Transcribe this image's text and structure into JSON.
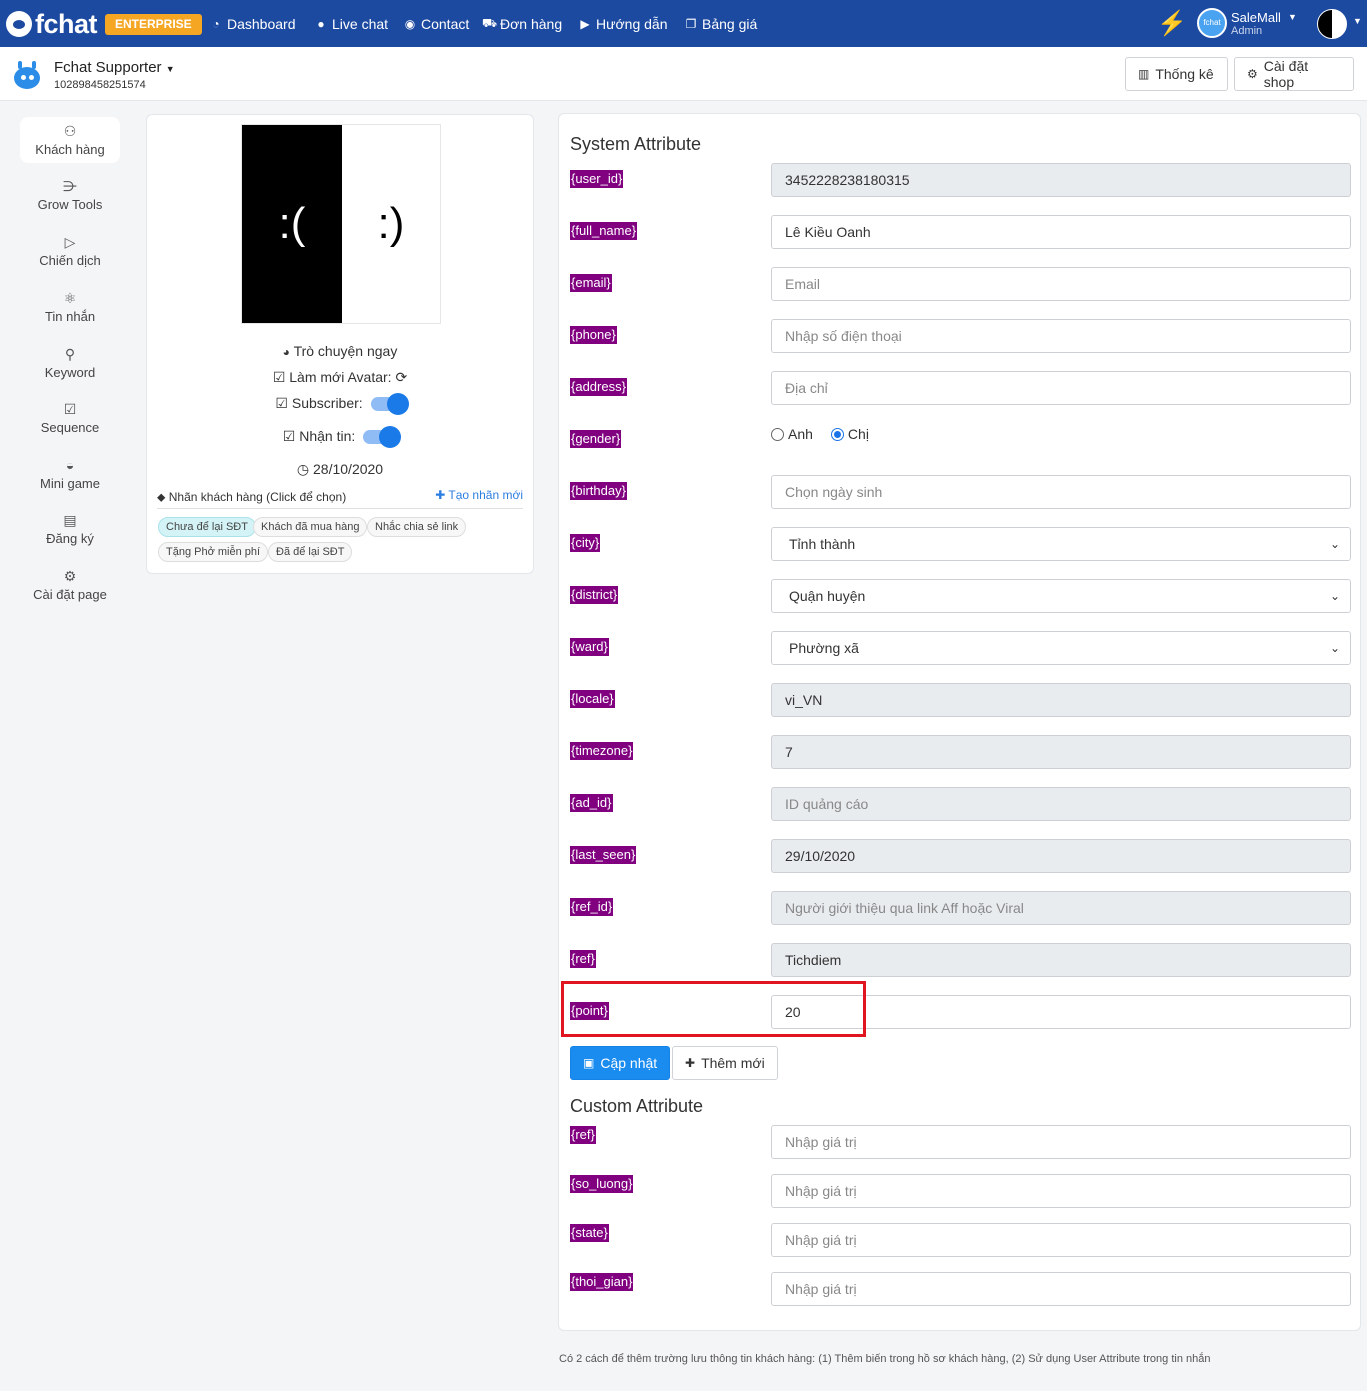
{
  "topbar": {
    "brand": "fchat",
    "badge": "ENTERPRISE",
    "nav": [
      {
        "label": "Dashboard",
        "icon": "dashboard-icon"
      },
      {
        "label": "Live chat",
        "icon": "chat-icon"
      },
      {
        "label": "Contact",
        "icon": "contact-icon"
      },
      {
        "label": "Đơn hàng",
        "icon": "cart-icon"
      },
      {
        "label": "Hướng dẫn",
        "icon": "play-icon"
      },
      {
        "label": "Bảng giá",
        "icon": "pricing-icon"
      }
    ],
    "account": {
      "name": "SaleMall",
      "role": "Admin",
      "avatar_text": "fchat"
    }
  },
  "page_header": {
    "page_name": "Fchat Supporter",
    "page_id": "102898458251574",
    "buttons": {
      "stats": "Thống kê",
      "settings": "Cài đặt shop"
    }
  },
  "sidebar": {
    "items": [
      {
        "label": "Khách hàng",
        "icon": "user-icon",
        "active": true
      },
      {
        "label": "Grow Tools",
        "icon": "grow-tools-icon"
      },
      {
        "label": "Chiến dịch",
        "icon": "campaign-icon"
      },
      {
        "label": "Tin nhắn",
        "icon": "message-icon"
      },
      {
        "label": "Keyword",
        "icon": "key-icon"
      },
      {
        "label": "Sequence",
        "icon": "calendar-icon"
      },
      {
        "label": "Mini game",
        "icon": "gamepad-icon"
      },
      {
        "label": "Đăng ký",
        "icon": "form-icon"
      },
      {
        "label": "Cài đặt page",
        "icon": "gear-icon"
      }
    ]
  },
  "profile": {
    "avatar_left": ":(",
    "avatar_right": ":)",
    "chat_now": "Trò chuyện ngay",
    "refresh_avatar": "Làm mới Avatar:",
    "subscriber": "Subscriber:",
    "subscriber_on": true,
    "receive_msg": "Nhận tin:",
    "receive_on": true,
    "date": "28/10/2020",
    "tags_title": "Nhãn khách hàng (Click để chọn)",
    "new_tag": "Tạo nhãn mới",
    "tags": [
      {
        "label": "Chưa để lại SĐT",
        "selected": true
      },
      {
        "label": "Khách đã mua hàng",
        "selected": false
      },
      {
        "label": "Nhắc chia sẻ link",
        "selected": false
      },
      {
        "label": "Tặng Phở miễn phí",
        "selected": false
      },
      {
        "label": "Đã để lại SĐT",
        "selected": false
      }
    ]
  },
  "system": {
    "title": "System Attribute",
    "fields": {
      "user_id": {
        "label": "{user_id}",
        "value": "3452228238180315"
      },
      "full_name": {
        "label": "{full_name}",
        "value": "Lê Kiều Oanh"
      },
      "email": {
        "label": "{email}",
        "placeholder": "Email"
      },
      "phone": {
        "label": "{phone}",
        "placeholder": "Nhập số điện thoại"
      },
      "address": {
        "label": "{address}",
        "placeholder": "Địa chỉ"
      },
      "gender": {
        "label": "{gender}",
        "options": [
          "Anh",
          "Chị"
        ],
        "selected": "Chị"
      },
      "birthday": {
        "label": "{birthday}",
        "placeholder": "Chọn ngày sinh"
      },
      "city": {
        "label": "{city}",
        "value": "Tỉnh thành"
      },
      "district": {
        "label": "{district}",
        "value": "Quận huyện"
      },
      "ward": {
        "label": "{ward}",
        "value": "Phường xã"
      },
      "locale": {
        "label": "{locale}",
        "value": "vi_VN"
      },
      "timezone": {
        "label": "{timezone}",
        "value": "7"
      },
      "ad_id": {
        "label": "{ad_id}",
        "placeholder": "ID quảng cáo"
      },
      "last_seen": {
        "label": "{last_seen}",
        "value": "29/10/2020"
      },
      "ref_id": {
        "label": "{ref_id}",
        "placeholder": "Người giới thiệu qua link Aff hoặc Viral"
      },
      "ref": {
        "label": "{ref}",
        "value": "Tichdiem"
      },
      "point": {
        "label": "{point}",
        "value": "20"
      }
    },
    "update_btn": "Cập nhật",
    "add_btn": "Thêm mới"
  },
  "custom": {
    "title": "Custom Attribute",
    "fields": [
      {
        "label": "{ref}",
        "placeholder": "Nhập giá trị"
      },
      {
        "label": "{so_luong}",
        "placeholder": "Nhập giá trị"
      },
      {
        "label": "{state}",
        "placeholder": "Nhập giá trị"
      },
      {
        "label": "{thoi_gian}",
        "placeholder": "Nhập giá trị"
      }
    ]
  },
  "footer": "Có 2 cách để thêm trường lưu thông tin khách hàng: (1) Thêm biến trong hồ sơ khách hàng, (2) Sử dụng User Attribute trong tin nhắn",
  "colors": {
    "navbar": "#1d4aa1",
    "badge": "#f5a623",
    "attr_label": "#800080",
    "primary": "#1a8cf0",
    "highlight": "#e0151f"
  }
}
